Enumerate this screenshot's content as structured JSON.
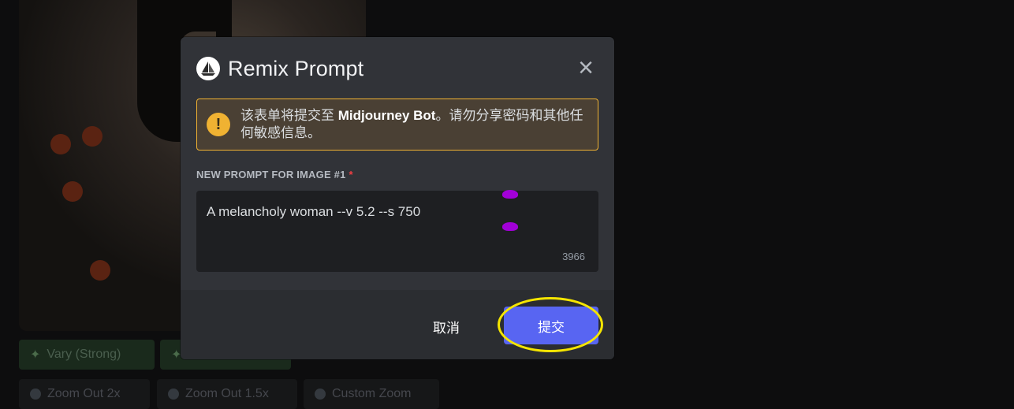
{
  "background": {
    "buttons_row1": [
      "Vary (Strong)",
      ""
    ],
    "buttons_row2": [
      "Zoom Out 2x",
      "Zoom Out 1.5x",
      "Custom Zoom"
    ]
  },
  "modal": {
    "title": "Remix Prompt",
    "app_icon": "midjourney-sailboat-icon",
    "close_icon": "close-icon",
    "warning": {
      "icon": "exclamation-icon",
      "text_before": "该表单将提交至 ",
      "bot_name": "Midjourney Bot",
      "text_after": "。请勿分享密码和其他任何敏感信息。"
    },
    "field_label": "NEW PROMPT FOR IMAGE #1",
    "required_mark": "*",
    "prompt_value": "A melancholy woman --v 5.2 --s 750",
    "char_remaining": "3966",
    "cancel_label": "取消",
    "submit_label": "提交"
  },
  "colors": {
    "modal_bg": "#313338",
    "footer_bg": "#2b2d31",
    "input_bg": "#1e1f22",
    "warning_border": "#f0b232",
    "submit": "#5865f2",
    "highlight": "#f5e500",
    "cursor_handles": "#a200d8"
  }
}
